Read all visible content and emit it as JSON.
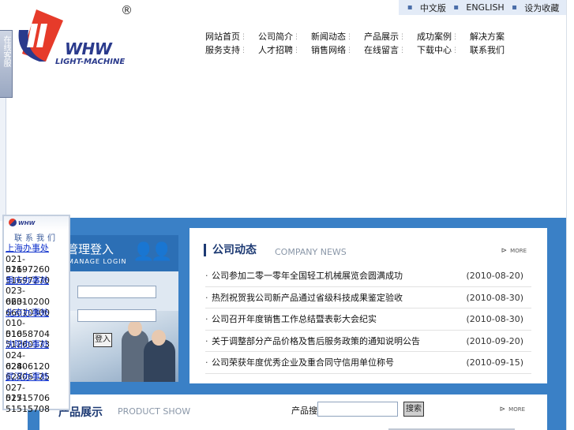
{
  "logo": {
    "brand": "WHW",
    "sub": "LIGHT-MACHINE",
    "reg": "®"
  },
  "online_tab": {
    "label": "在线客服"
  },
  "lang": {
    "items": [
      "中文版",
      "ENGLISH",
      "设为收藏"
    ]
  },
  "nav": {
    "row1": [
      "网站首页",
      "公司简介",
      "新闻动态",
      "产品展示",
      "成功案例",
      "解决方案"
    ],
    "row2": [
      "服务支持",
      "人才招聘",
      "销售网络",
      "在线留言",
      "下载中心",
      "联系我们"
    ]
  },
  "login": {
    "title": "管理登入",
    "title_en": "MANAGE LOGIN",
    "submit": "登入"
  },
  "news": {
    "title": "公司动态",
    "title_en": "COMPANY NEWS",
    "more": "MORE",
    "items": [
      {
        "text": "公司参加二零一零年全国轻工机械展览会圆满成功",
        "date": "(2010-08-20)"
      },
      {
        "text": "热烈祝贺我公司新产品通过省级科技成果鉴定验收",
        "date": "(2010-08-30)"
      },
      {
        "text": "公司召开年度销售工作总结暨表彰大会纪实",
        "date": "(2010-08-30)"
      },
      {
        "text": "关于调整部分产品价格及售后服务政策的通知说明公告",
        "date": "(2010-09-20)"
      },
      {
        "text": "公司荣获年度优秀企业及重合同守信用单位称号",
        "date": "(2010-09-15)"
      }
    ]
  },
  "product": {
    "title": "产品展示",
    "title_en": "PRODUCT SHOW",
    "search_label": "产品搜索:",
    "search_button": "搜索",
    "more": "MORE"
  },
  "contact": {
    "header": "联系我们",
    "entries": [
      {
        "city": "上海办事处",
        "tels": [
          "021-51697260",
          "021-51697270"
        ]
      },
      {
        "city": "重庆办事处",
        "tels": [
          "023-66010200",
          "023-66010300"
        ]
      },
      {
        "city": "北京办事处",
        "tels": [
          "010-51658704",
          "010-51260173"
        ]
      },
      {
        "city": "沈阳办事处",
        "tels": [
          "024-62806120",
          "024-62806125"
        ]
      },
      {
        "city": "武汉办事处",
        "tels": [
          "027-51515706",
          "027-51515708"
        ]
      }
    ]
  }
}
